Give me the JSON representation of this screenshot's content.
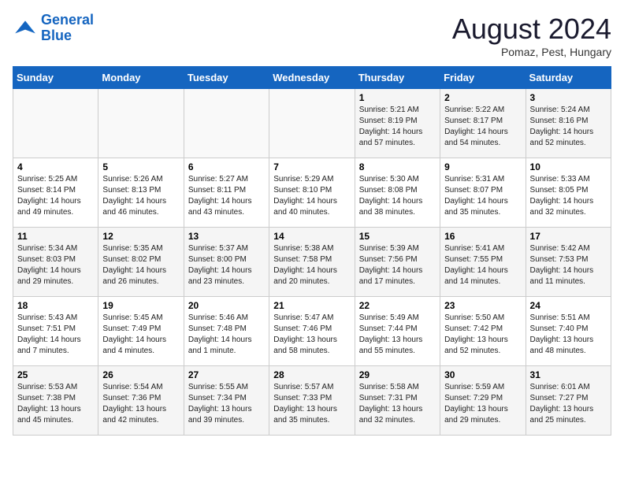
{
  "logo": {
    "line1": "General",
    "line2": "Blue"
  },
  "title": "August 2024",
  "subtitle": "Pomaz, Pest, Hungary",
  "days_of_week": [
    "Sunday",
    "Monday",
    "Tuesday",
    "Wednesday",
    "Thursday",
    "Friday",
    "Saturday"
  ],
  "weeks": [
    [
      {
        "day": "",
        "info": ""
      },
      {
        "day": "",
        "info": ""
      },
      {
        "day": "",
        "info": ""
      },
      {
        "day": "",
        "info": ""
      },
      {
        "day": "1",
        "info": "Sunrise: 5:21 AM\nSunset: 8:19 PM\nDaylight: 14 hours\nand 57 minutes."
      },
      {
        "day": "2",
        "info": "Sunrise: 5:22 AM\nSunset: 8:17 PM\nDaylight: 14 hours\nand 54 minutes."
      },
      {
        "day": "3",
        "info": "Sunrise: 5:24 AM\nSunset: 8:16 PM\nDaylight: 14 hours\nand 52 minutes."
      }
    ],
    [
      {
        "day": "4",
        "info": "Sunrise: 5:25 AM\nSunset: 8:14 PM\nDaylight: 14 hours\nand 49 minutes."
      },
      {
        "day": "5",
        "info": "Sunrise: 5:26 AM\nSunset: 8:13 PM\nDaylight: 14 hours\nand 46 minutes."
      },
      {
        "day": "6",
        "info": "Sunrise: 5:27 AM\nSunset: 8:11 PM\nDaylight: 14 hours\nand 43 minutes."
      },
      {
        "day": "7",
        "info": "Sunrise: 5:29 AM\nSunset: 8:10 PM\nDaylight: 14 hours\nand 40 minutes."
      },
      {
        "day": "8",
        "info": "Sunrise: 5:30 AM\nSunset: 8:08 PM\nDaylight: 14 hours\nand 38 minutes."
      },
      {
        "day": "9",
        "info": "Sunrise: 5:31 AM\nSunset: 8:07 PM\nDaylight: 14 hours\nand 35 minutes."
      },
      {
        "day": "10",
        "info": "Sunrise: 5:33 AM\nSunset: 8:05 PM\nDaylight: 14 hours\nand 32 minutes."
      }
    ],
    [
      {
        "day": "11",
        "info": "Sunrise: 5:34 AM\nSunset: 8:03 PM\nDaylight: 14 hours\nand 29 minutes."
      },
      {
        "day": "12",
        "info": "Sunrise: 5:35 AM\nSunset: 8:02 PM\nDaylight: 14 hours\nand 26 minutes."
      },
      {
        "day": "13",
        "info": "Sunrise: 5:37 AM\nSunset: 8:00 PM\nDaylight: 14 hours\nand 23 minutes."
      },
      {
        "day": "14",
        "info": "Sunrise: 5:38 AM\nSunset: 7:58 PM\nDaylight: 14 hours\nand 20 minutes."
      },
      {
        "day": "15",
        "info": "Sunrise: 5:39 AM\nSunset: 7:56 PM\nDaylight: 14 hours\nand 17 minutes."
      },
      {
        "day": "16",
        "info": "Sunrise: 5:41 AM\nSunset: 7:55 PM\nDaylight: 14 hours\nand 14 minutes."
      },
      {
        "day": "17",
        "info": "Sunrise: 5:42 AM\nSunset: 7:53 PM\nDaylight: 14 hours\nand 11 minutes."
      }
    ],
    [
      {
        "day": "18",
        "info": "Sunrise: 5:43 AM\nSunset: 7:51 PM\nDaylight: 14 hours\nand 7 minutes."
      },
      {
        "day": "19",
        "info": "Sunrise: 5:45 AM\nSunset: 7:49 PM\nDaylight: 14 hours\nand 4 minutes."
      },
      {
        "day": "20",
        "info": "Sunrise: 5:46 AM\nSunset: 7:48 PM\nDaylight: 14 hours\nand 1 minute."
      },
      {
        "day": "21",
        "info": "Sunrise: 5:47 AM\nSunset: 7:46 PM\nDaylight: 13 hours\nand 58 minutes."
      },
      {
        "day": "22",
        "info": "Sunrise: 5:49 AM\nSunset: 7:44 PM\nDaylight: 13 hours\nand 55 minutes."
      },
      {
        "day": "23",
        "info": "Sunrise: 5:50 AM\nSunset: 7:42 PM\nDaylight: 13 hours\nand 52 minutes."
      },
      {
        "day": "24",
        "info": "Sunrise: 5:51 AM\nSunset: 7:40 PM\nDaylight: 13 hours\nand 48 minutes."
      }
    ],
    [
      {
        "day": "25",
        "info": "Sunrise: 5:53 AM\nSunset: 7:38 PM\nDaylight: 13 hours\nand 45 minutes."
      },
      {
        "day": "26",
        "info": "Sunrise: 5:54 AM\nSunset: 7:36 PM\nDaylight: 13 hours\nand 42 minutes."
      },
      {
        "day": "27",
        "info": "Sunrise: 5:55 AM\nSunset: 7:34 PM\nDaylight: 13 hours\nand 39 minutes."
      },
      {
        "day": "28",
        "info": "Sunrise: 5:57 AM\nSunset: 7:33 PM\nDaylight: 13 hours\nand 35 minutes."
      },
      {
        "day": "29",
        "info": "Sunrise: 5:58 AM\nSunset: 7:31 PM\nDaylight: 13 hours\nand 32 minutes."
      },
      {
        "day": "30",
        "info": "Sunrise: 5:59 AM\nSunset: 7:29 PM\nDaylight: 13 hours\nand 29 minutes."
      },
      {
        "day": "31",
        "info": "Sunrise: 6:01 AM\nSunset: 7:27 PM\nDaylight: 13 hours\nand 25 minutes."
      }
    ]
  ]
}
